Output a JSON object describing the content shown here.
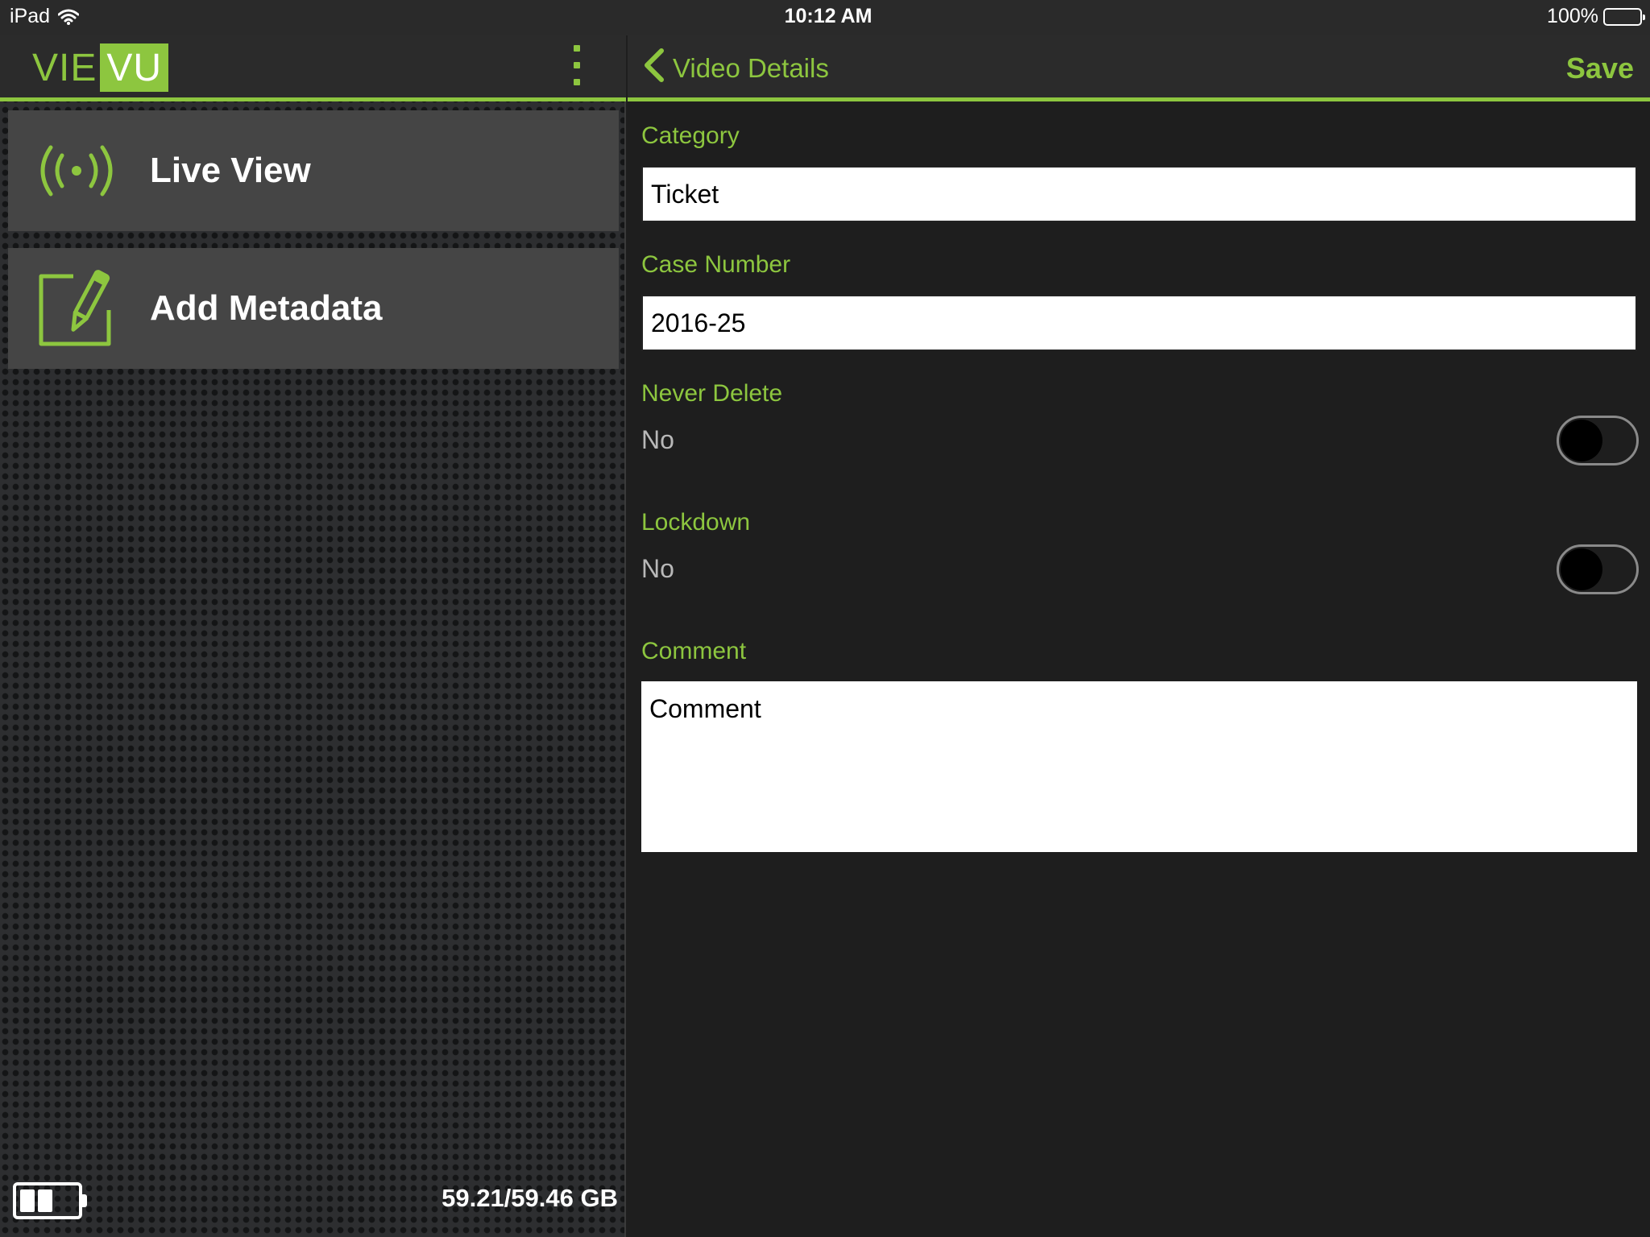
{
  "status_bar": {
    "device": "iPad",
    "time": "10:12 AM",
    "battery": "100%"
  },
  "sidebar": {
    "logo": {
      "part1": "VIE",
      "part2": "VU"
    },
    "items": [
      {
        "label": "Live View",
        "icon": "broadcast-icon"
      },
      {
        "label": "Add Metadata",
        "icon": "edit-pencil-icon"
      }
    ],
    "footer": {
      "storage": "59.21/59.46 GB",
      "device_battery_icon": "device-battery-icon"
    }
  },
  "details": {
    "nav": {
      "back_label": "Video Details",
      "save_label": "Save"
    },
    "fields": {
      "category": {
        "label": "Category",
        "value": "Ticket"
      },
      "case_number": {
        "label": "Case Number",
        "value": "2016-25"
      },
      "never_delete": {
        "label": "Never Delete",
        "value": "No",
        "on": false
      },
      "lockdown": {
        "label": "Lockdown",
        "value": "No",
        "on": false
      },
      "comment": {
        "label": "Comment",
        "placeholder": "Comment"
      }
    }
  },
  "colors": {
    "accent": "#8dc63f",
    "panel": "#454545",
    "background": "#1e1e1e",
    "header": "#2b2b2b"
  }
}
